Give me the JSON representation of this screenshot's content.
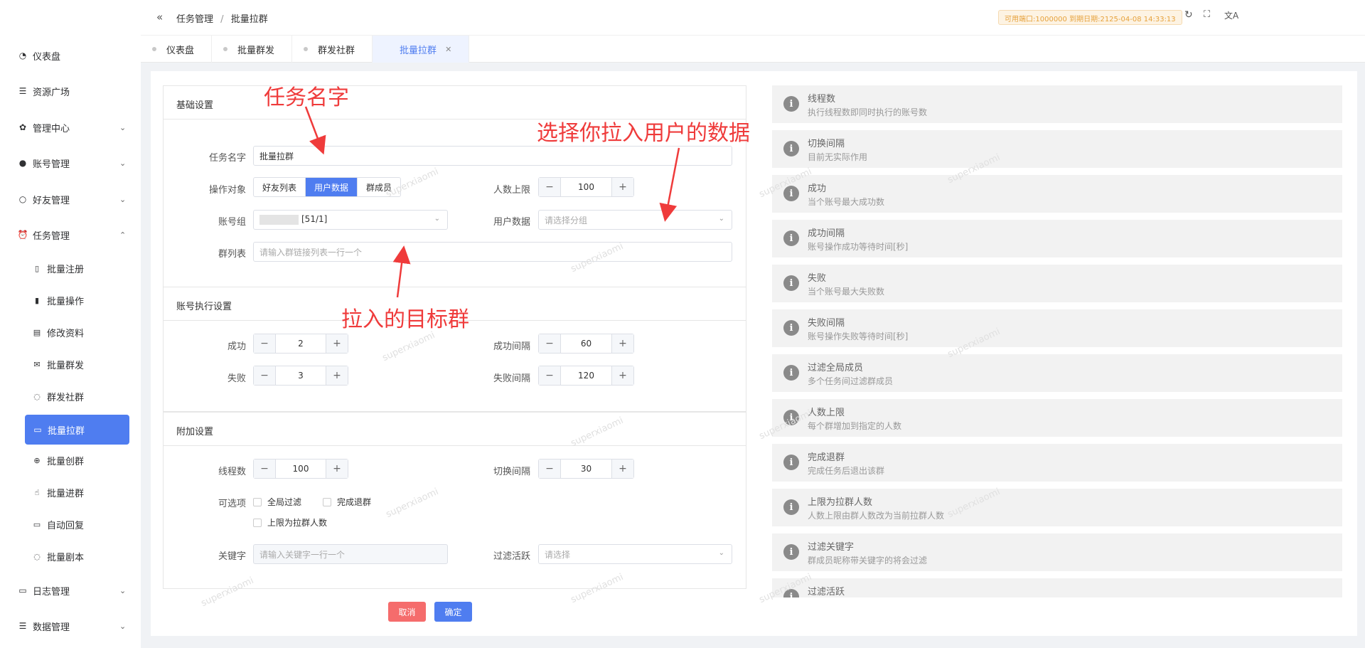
{
  "breadcrumb": {
    "parent": "任务管理",
    "current": "批量拉群"
  },
  "license_badge": "可用端口:1000000 到期日期:2125-04-08 14:33:13",
  "sidebar": {
    "items": [
      {
        "label": "仪表盘",
        "icon": "dashboard-icon"
      },
      {
        "label": "资源广场",
        "icon": "database-icon"
      },
      {
        "label": "管理中心",
        "icon": "gear-icon"
      },
      {
        "label": "账号管理",
        "icon": "user-icon"
      },
      {
        "label": "好友管理",
        "icon": "user-outline-icon"
      },
      {
        "label": "任务管理",
        "icon": "alarm-icon"
      },
      {
        "label": "批量注册",
        "icon": "phone-icon"
      },
      {
        "label": "批量操作",
        "icon": "clipboard-icon"
      },
      {
        "label": "修改资料",
        "icon": "document-icon"
      },
      {
        "label": "批量群发",
        "icon": "mail-icon"
      },
      {
        "label": "群发社群",
        "icon": "chat-icon"
      },
      {
        "label": "批量拉群",
        "icon": "chat-icon"
      },
      {
        "label": "批量创群",
        "icon": "plus-circle-icon"
      },
      {
        "label": "批量进群",
        "icon": "hand-icon"
      },
      {
        "label": "自动回复",
        "icon": "message-icon"
      },
      {
        "label": "批量剧本",
        "icon": "chat-icon"
      },
      {
        "label": "日志管理",
        "icon": "message-icon"
      },
      {
        "label": "数据管理",
        "icon": "database-icon"
      }
    ]
  },
  "tabs": [
    "仪表盘",
    "批量群发",
    "群发社群",
    "批量拉群"
  ],
  "basic": {
    "title": "基础设置",
    "task_name_label": "任务名字",
    "task_name_value": "批量拉群",
    "target_label": "操作对象",
    "target_options": [
      "好友列表",
      "用户数据",
      "群成员"
    ],
    "max_people_label": "人数上限",
    "max_people_value": "100",
    "account_group_label": "账号组",
    "account_group_value": "[51/1]",
    "user_data_label": "用户数据",
    "user_data_placeholder": "请选择分组",
    "group_list_label": "群列表",
    "group_list_placeholder": "请输入群链接列表一行一个"
  },
  "exec": {
    "title": "账号执行设置",
    "success_label": "成功",
    "success_value": "2",
    "success_interval_label": "成功间隔",
    "success_interval_value": "60",
    "fail_label": "失败",
    "fail_value": "3",
    "fail_interval_label": "失败间隔",
    "fail_interval_value": "120"
  },
  "extra": {
    "title": "附加设置",
    "threads_label": "线程数",
    "threads_value": "100",
    "switch_label": "切换间隔",
    "switch_value": "30",
    "options_label": "可选项",
    "opt_global": "全局过滤",
    "opt_exit": "完成退群",
    "opt_limit": "上限为拉群人数",
    "keyword_label": "关键字",
    "keyword_placeholder": "请输入关键字一行一个",
    "active_label": "过滤活跃",
    "active_placeholder": "请选择"
  },
  "buttons": {
    "cancel": "取消",
    "confirm": "确定"
  },
  "info": [
    {
      "t": "线程数",
      "d": "执行线程数即同时执行的账号数"
    },
    {
      "t": "切换间隔",
      "d": "目前无实际作用"
    },
    {
      "t": "成功",
      "d": "当个账号最大成功数"
    },
    {
      "t": "成功间隔",
      "d": "账号操作成功等待时间[秒]"
    },
    {
      "t": "失败",
      "d": "当个账号最大失败数"
    },
    {
      "t": "失败间隔",
      "d": "账号操作失败等待时间[秒]"
    },
    {
      "t": "过滤全局成员",
      "d": "多个任务间过滤群成员"
    },
    {
      "t": "人数上限",
      "d": "每个群增加到指定的人数"
    },
    {
      "t": "完成退群",
      "d": "完成任务后退出该群"
    },
    {
      "t": "上限为拉群人数",
      "d": "人数上限由群人数改为当前拉群人数"
    },
    {
      "t": "过滤关键字",
      "d": "群成员昵称带关键字的将会过滤"
    },
    {
      "t": "过滤活跃",
      "d": ""
    }
  ],
  "annotations": {
    "a1": "任务名字",
    "a2": "选择你拉入用户的数据",
    "a3": "拉入的目标群"
  },
  "watermark": "superxiaomi",
  "colors": {
    "primary": "#4f7df0",
    "danger": "#f56c6c",
    "annotation": "#ef3b3b"
  }
}
